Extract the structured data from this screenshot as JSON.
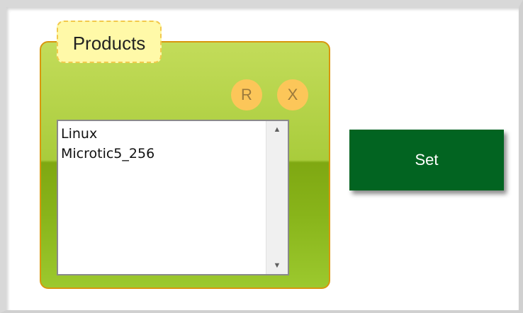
{
  "products_panel": {
    "title": "Products",
    "reset_button_label": "R",
    "close_button_label": "X",
    "list_items": [
      "Linux",
      "Microtic5_256"
    ]
  },
  "set_button": {
    "label": "Set"
  },
  "scrollbar": {
    "up_icon": "scroll-up-arrow",
    "down_icon": "scroll-down-arrow"
  },
  "colors": {
    "panel_green": "#a9cc3c",
    "panel_border": "#d9960e",
    "title_bg": "#fff9a8",
    "round_button": "#fcc659",
    "set_button": "#026421"
  }
}
